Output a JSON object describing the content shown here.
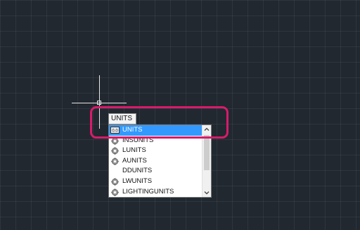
{
  "command_input": {
    "value": "UNITS"
  },
  "autocomplete": {
    "items": [
      {
        "label": "UNITS",
        "icon": "units-dialog-icon",
        "selected": true
      },
      {
        "label": "INSUNITS",
        "icon": "gear-icon",
        "selected": false
      },
      {
        "label": "LUNITS",
        "icon": "gear-icon",
        "selected": false
      },
      {
        "label": "AUNITS",
        "icon": "gear-icon",
        "selected": false
      },
      {
        "label": "DDUNITS",
        "icon": "",
        "selected": false
      },
      {
        "label": "LWUNITS",
        "icon": "gear-icon",
        "selected": false
      },
      {
        "label": "LIGHTINGUNITS",
        "icon": "gear-icon",
        "selected": false
      }
    ],
    "scroll_up_glyph": "^",
    "scroll_down_glyph": "v"
  },
  "colors": {
    "background": "#212830",
    "selection": "#3399ff",
    "highlight": "#d81b6a"
  }
}
